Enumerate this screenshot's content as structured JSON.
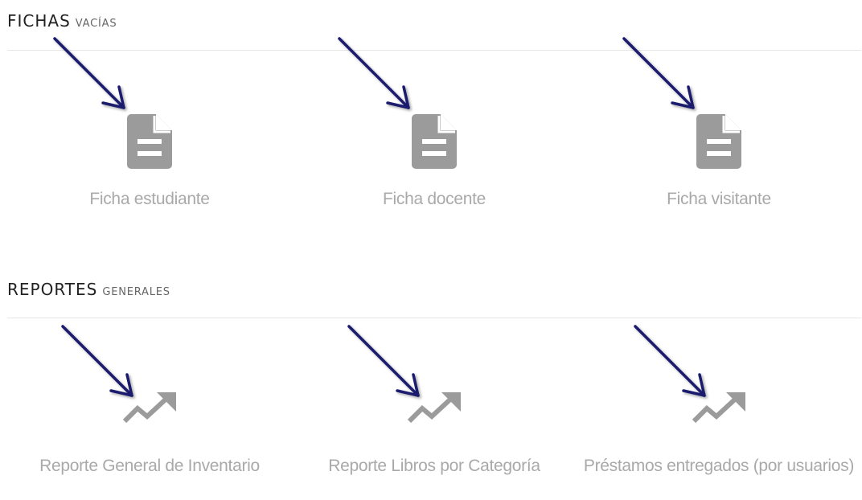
{
  "fichas": {
    "title": "FICHAS",
    "subtitle": "VACÍAS",
    "items": [
      {
        "label": "Ficha estudiante",
        "icon": "document-icon"
      },
      {
        "label": "Ficha docente",
        "icon": "document-icon"
      },
      {
        "label": "Ficha visitante",
        "icon": "document-icon"
      }
    ]
  },
  "reportes": {
    "title": "REPORTES",
    "subtitle": "GENERALES",
    "items": [
      {
        "label": "Reporte General de Inventario",
        "icon": "trending-up-icon"
      },
      {
        "label": "Reporte Libros por Categoría",
        "icon": "trending-up-icon"
      },
      {
        "label": "Préstamos entregados (por usuarios)",
        "icon": "trending-up-icon"
      }
    ]
  },
  "colors": {
    "icon": "#9b9b9b",
    "label": "#a9a9a9",
    "annotation_arrow": "#1a1a6e"
  }
}
